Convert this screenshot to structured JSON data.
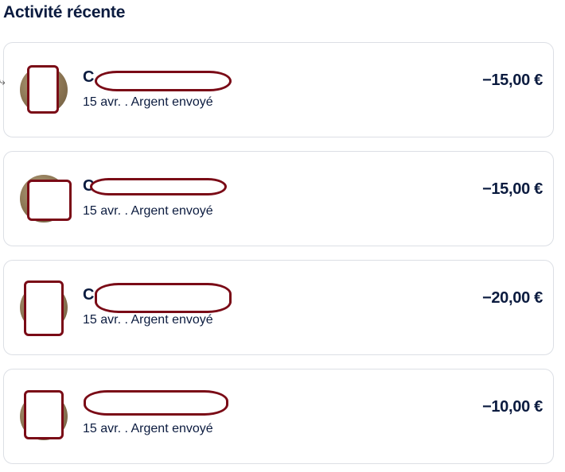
{
  "section": {
    "title": "Activité récente"
  },
  "transactions": [
    {
      "name_initial": "C",
      "date": "15 avr.",
      "separator": ".",
      "type": "Argent envoyé",
      "amount": "−15,00 €"
    },
    {
      "name_initial": "C",
      "date": "15 avr.",
      "separator": ".",
      "type": "Argent envoyé",
      "amount": "−15,00 €"
    },
    {
      "name_initial": "C",
      "date": "15 avr.",
      "separator": ".",
      "type": "Argent envoyé",
      "amount": "−20,00 €"
    },
    {
      "name_initial": "",
      "date": "15 avr.",
      "separator": ".",
      "type": "Argent envoyé",
      "amount": "−10,00 €"
    }
  ],
  "colors": {
    "text_primary": "#0b1b3f",
    "redaction_border": "#7a0a16",
    "card_border": "#dcdfe5"
  }
}
